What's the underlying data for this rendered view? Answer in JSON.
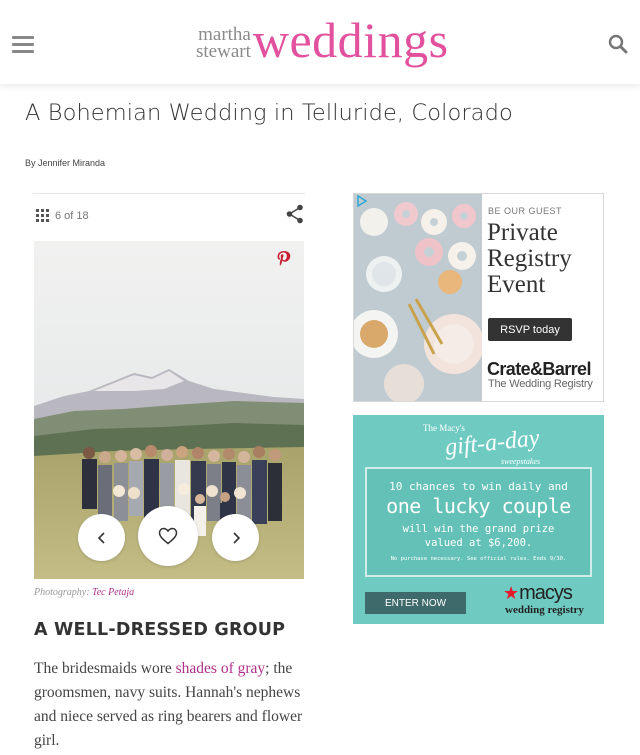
{
  "header": {
    "logo_small_line1": "martha",
    "logo_small_line2": "stewart",
    "logo_big": "weddings",
    "brand_color": "#e2519d"
  },
  "article": {
    "title": "A Bohemian Wedding in Telluride, Colorado",
    "byline": "By Jennifer Miranda"
  },
  "gallery": {
    "counter": "6 of 18",
    "credit_label": "Photography:",
    "credit_name": "Tec Petaja",
    "heading": "A WELL-DRESSED GROUP",
    "body_before": "The bridesmaids wore ",
    "body_link": "shades of gray",
    "body_after": "; the groomsmen, navy suits. Hannah's nephews and niece served as ring bearers and flower girl.",
    "icons": [
      "grid-icon",
      "share-icon",
      "pinterest-icon",
      "chevron-left-icon",
      "heart-icon",
      "chevron-right-icon"
    ]
  },
  "ad1": {
    "eyebrow": "BE OUR GUEST",
    "headline_line1": "Private",
    "headline_line2": "Registry",
    "headline_line3": "Event",
    "button": "RSVP today",
    "brand": "Crate&Barrel",
    "brand_sub": "The Wedding Registry"
  },
  "ad2": {
    "top": "The Macy's",
    "title": "gift-a-day",
    "subtitle": "sweepstakes",
    "line1": "10 chances to win daily and",
    "line2": "one lucky couple",
    "line3a": "will win the grand prize",
    "line3b": "valued at $6,200.",
    "fine_print": "No purchase necessary. See official rules. Ends 9/30.",
    "button": "ENTER NOW",
    "logo": "macys",
    "logo_sub": "wedding registry",
    "bg_color": "#6fcbc2"
  }
}
